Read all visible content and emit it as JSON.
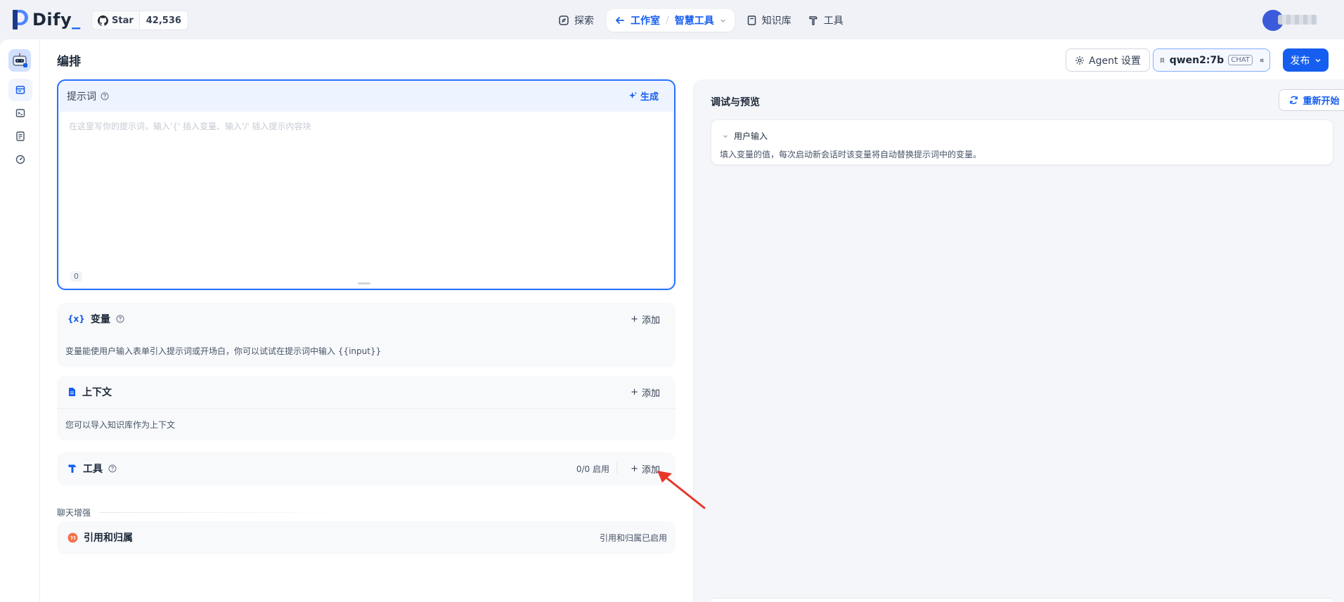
{
  "brand": {
    "name": "Dify",
    "accent": "#155eef"
  },
  "github": {
    "star_label": "Star",
    "count": "42,536"
  },
  "nav": {
    "explore": "探索",
    "studio": "工作室",
    "separator": "/",
    "current_app": "智慧工具",
    "knowledge": "知识库",
    "tools": "工具"
  },
  "header": {
    "title": "编排",
    "agent_settings": "Agent 设置",
    "model_name": "qwen2:7b",
    "model_mode": "CHAT",
    "publish": "发布"
  },
  "prompt": {
    "label": "提示词",
    "generate": "生成",
    "placeholder": "在这里写你的提示词，输入'{' 插入变量、输入'/' 插入提示内容块",
    "char_count": "0"
  },
  "variables": {
    "label": "变量",
    "add": "添加",
    "description": "变量能使用户输入表单引入提示词或开场白，你可以试试在提示词中输入 {{input}}"
  },
  "context": {
    "label": "上下文",
    "add": "添加",
    "description": "您可以导入知识库作为上下文"
  },
  "tools": {
    "label": "工具",
    "status": "0/0 启用",
    "add": "添加"
  },
  "chat_enhance": {
    "section_label": "聊天增强",
    "citation_label": "引用和归属",
    "citation_status": "引用和归属已启用"
  },
  "preview": {
    "title": "调试与预览",
    "restart": "重新开始",
    "user_input_title": "用户输入",
    "user_input_desc": "填入变量的值，每次启动新会话时该变量将自动替换提示词中的变量。"
  },
  "colors": {
    "annotation_arrow": "#e8352a",
    "primary": "#155eef"
  }
}
